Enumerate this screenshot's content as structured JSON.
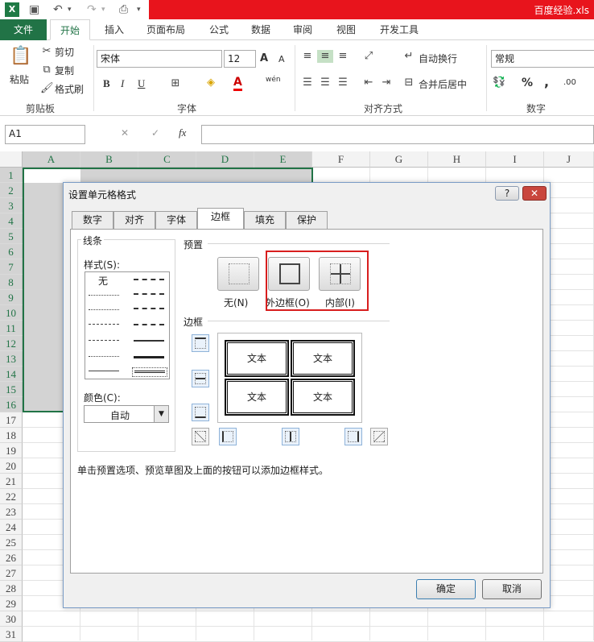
{
  "app": {
    "filename": "百度经验.xls",
    "xl_glyph": "X"
  },
  "tabs": [
    "文件",
    "开始",
    "插入",
    "页面布局",
    "公式",
    "数据",
    "审阅",
    "视图",
    "开发工具"
  ],
  "ribbon": {
    "clipboard": {
      "paste": "粘贴",
      "cut": "剪切",
      "copy": "复制",
      "format_painter": "格式刷",
      "group": "剪贴板"
    },
    "font": {
      "name": "宋体",
      "size": "12",
      "bold": "B",
      "italic": "I",
      "underline": "U",
      "grow": "A",
      "shrink": "A",
      "phonetic": "wén",
      "font_color": "A",
      "group": "字体"
    },
    "alignment": {
      "wrap": "自动换行",
      "merge": "合并后居中",
      "group": "对齐方式"
    },
    "number": {
      "format": "常规",
      "percent": "%",
      "comma": ",",
      "inc": ".00",
      "group": "数字"
    }
  },
  "formula_bar": {
    "name_box": "A1",
    "fx": "fx",
    "cancel": "✕",
    "enter": "✓"
  },
  "sheet": {
    "columns": [
      "A",
      "B",
      "C",
      "D",
      "E",
      "F",
      "G",
      "H",
      "I",
      "J"
    ],
    "rows": [
      "1",
      "2",
      "3",
      "4",
      "5",
      "6",
      "7",
      "8",
      "9",
      "10",
      "11",
      "12",
      "13",
      "14",
      "15",
      "16",
      "17",
      "18",
      "19",
      "20",
      "21",
      "22",
      "23",
      "24",
      "25",
      "26",
      "27",
      "28",
      "29",
      "30",
      "31"
    ]
  },
  "dialog": {
    "title": "设置单元格格式",
    "help": "?",
    "close": "✕",
    "tabs": [
      "数字",
      "对齐",
      "字体",
      "边框",
      "填充",
      "保护"
    ],
    "line_section": "线条",
    "style_label": "样式(S):",
    "style_none": "无",
    "color_label": "颜色(C):",
    "color_value": "自动",
    "presets_section": "预置",
    "preset_none": "无(N)",
    "preset_outline": "外边框(O)",
    "preset_inside": "内部(I)",
    "border_section": "边框",
    "preview_text": [
      "文本",
      "文本",
      "文本",
      "文本"
    ],
    "hint": "单击预置选项、预览草图及上面的按钮可以添加边框样式。",
    "ok": "确定",
    "cancel": "取消",
    "highlight_color": "#d81e1e"
  }
}
